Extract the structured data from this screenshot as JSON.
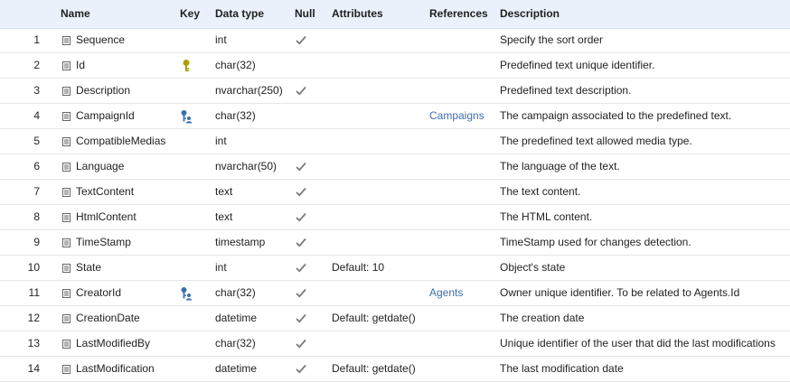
{
  "headers": {
    "name": "Name",
    "key": "Key",
    "data_type": "Data type",
    "null": "Null",
    "attributes": "Attributes",
    "references": "References",
    "description": "Description"
  },
  "colors": {
    "header_bg": "#eaf1fb",
    "link": "#3a6fb4",
    "primary_key": "#a8a000",
    "foreign_key": "#3a6fb4",
    "check": "#7a7a7a"
  },
  "rows": [
    {
      "num": "1",
      "name": "Sequence",
      "key": "",
      "type": "int",
      "null": true,
      "attributes": "",
      "references": "",
      "description": "Specify the sort order"
    },
    {
      "num": "2",
      "name": "Id",
      "key": "primary-key-icon",
      "type": "char(32)",
      "null": false,
      "attributes": "",
      "references": "",
      "description": "Predefined text unique identifier."
    },
    {
      "num": "3",
      "name": "Description",
      "key": "",
      "type": "nvarchar(250)",
      "null": true,
      "attributes": "",
      "references": "",
      "description": "Predefined text description."
    },
    {
      "num": "4",
      "name": "CampaignId",
      "key": "foreign-key-icon",
      "type": "char(32)",
      "null": false,
      "attributes": "",
      "references": "Campaigns",
      "description": "The campaign associated to the predefined text."
    },
    {
      "num": "5",
      "name": "CompatibleMedias",
      "key": "",
      "type": "int",
      "null": false,
      "attributes": "",
      "references": "",
      "description": "The predefined text allowed media type."
    },
    {
      "num": "6",
      "name": "Language",
      "key": "",
      "type": "nvarchar(50)",
      "null": true,
      "attributes": "",
      "references": "",
      "description": "The language of the text."
    },
    {
      "num": "7",
      "name": "TextContent",
      "key": "",
      "type": "text",
      "null": true,
      "attributes": "",
      "references": "",
      "description": "The text content."
    },
    {
      "num": "8",
      "name": "HtmlContent",
      "key": "",
      "type": "text",
      "null": true,
      "attributes": "",
      "references": "",
      "description": "The HTML content."
    },
    {
      "num": "9",
      "name": "TimeStamp",
      "key": "",
      "type": "timestamp",
      "null": true,
      "attributes": "",
      "references": "",
      "description": "TimeStamp used for changes detection."
    },
    {
      "num": "10",
      "name": "State",
      "key": "",
      "type": "int",
      "null": true,
      "attributes": "Default: 10",
      "references": "",
      "description": "Object's state"
    },
    {
      "num": "11",
      "name": "CreatorId",
      "key": "foreign-key-icon",
      "type": "char(32)",
      "null": true,
      "attributes": "",
      "references": "Agents",
      "description": "Owner unique identifier. To be related to Agents.Id"
    },
    {
      "num": "12",
      "name": "CreationDate",
      "key": "",
      "type": "datetime",
      "null": true,
      "attributes": "Default: getdate()",
      "references": "",
      "description": "The creation date"
    },
    {
      "num": "13",
      "name": "LastModifiedBy",
      "key": "",
      "type": "char(32)",
      "null": true,
      "attributes": "",
      "references": "",
      "description": "Unique identifier of the user that did the last modifications"
    },
    {
      "num": "14",
      "name": "LastModification",
      "key": "",
      "type": "datetime",
      "null": true,
      "attributes": "Default: getdate()",
      "references": "",
      "description": "The last modification date"
    }
  ]
}
